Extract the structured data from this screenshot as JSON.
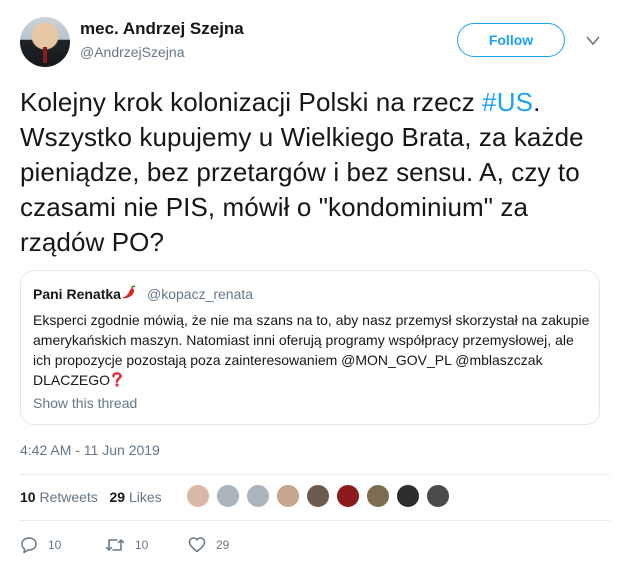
{
  "user": {
    "name": "mec. Andrzej Szejna",
    "handle": "@AndrzejSzejna",
    "follow_label": "Follow"
  },
  "tweet": {
    "text_before": "Kolejny krok kolonizacji Polski na rzecz ",
    "hashtag": "#US",
    "text_after": ". Wszystko kupujemy u Wielkiego Brata, za każde pieniądze, bez przetargów i bez sensu. A, czy to czasami nie PIS, mówił o \"kondominium\" za rządów PO?"
  },
  "quoted": {
    "name": "Pani Renatka",
    "handle": "@kopacz_renata",
    "text": "Eksperci zgodnie mówią, że nie ma szans na to, aby nasz przemysł skorzystał na zakupie amerykańskich maszyn. Natomiast inni oferują programy współpracy przemysłowej, ale ich propozycje pozostają poza zainteresowaniem @MON_GOV_PL @mblaszczak DLACZEGO",
    "show_thread": "Show this thread"
  },
  "timestamp": "4:42 AM - 11 Jun 2019",
  "stats": {
    "retweets_count": "10",
    "retweets_label": "Retweets",
    "likes_count": "29",
    "likes_label": "Likes"
  },
  "likers": [
    "#d9b8a8",
    "#aab4bd",
    "#aab4bd",
    "#c6a58a",
    "#6d5a4e",
    "#8b1a1a",
    "#7d6b52",
    "#2c2c2c",
    "#4a4a4a"
  ],
  "actions": {
    "replies": "10",
    "retweets": "10",
    "likes": "29"
  },
  "colors": {
    "accent": "#1da1f2",
    "muted": "#657786",
    "text": "#14171a"
  }
}
